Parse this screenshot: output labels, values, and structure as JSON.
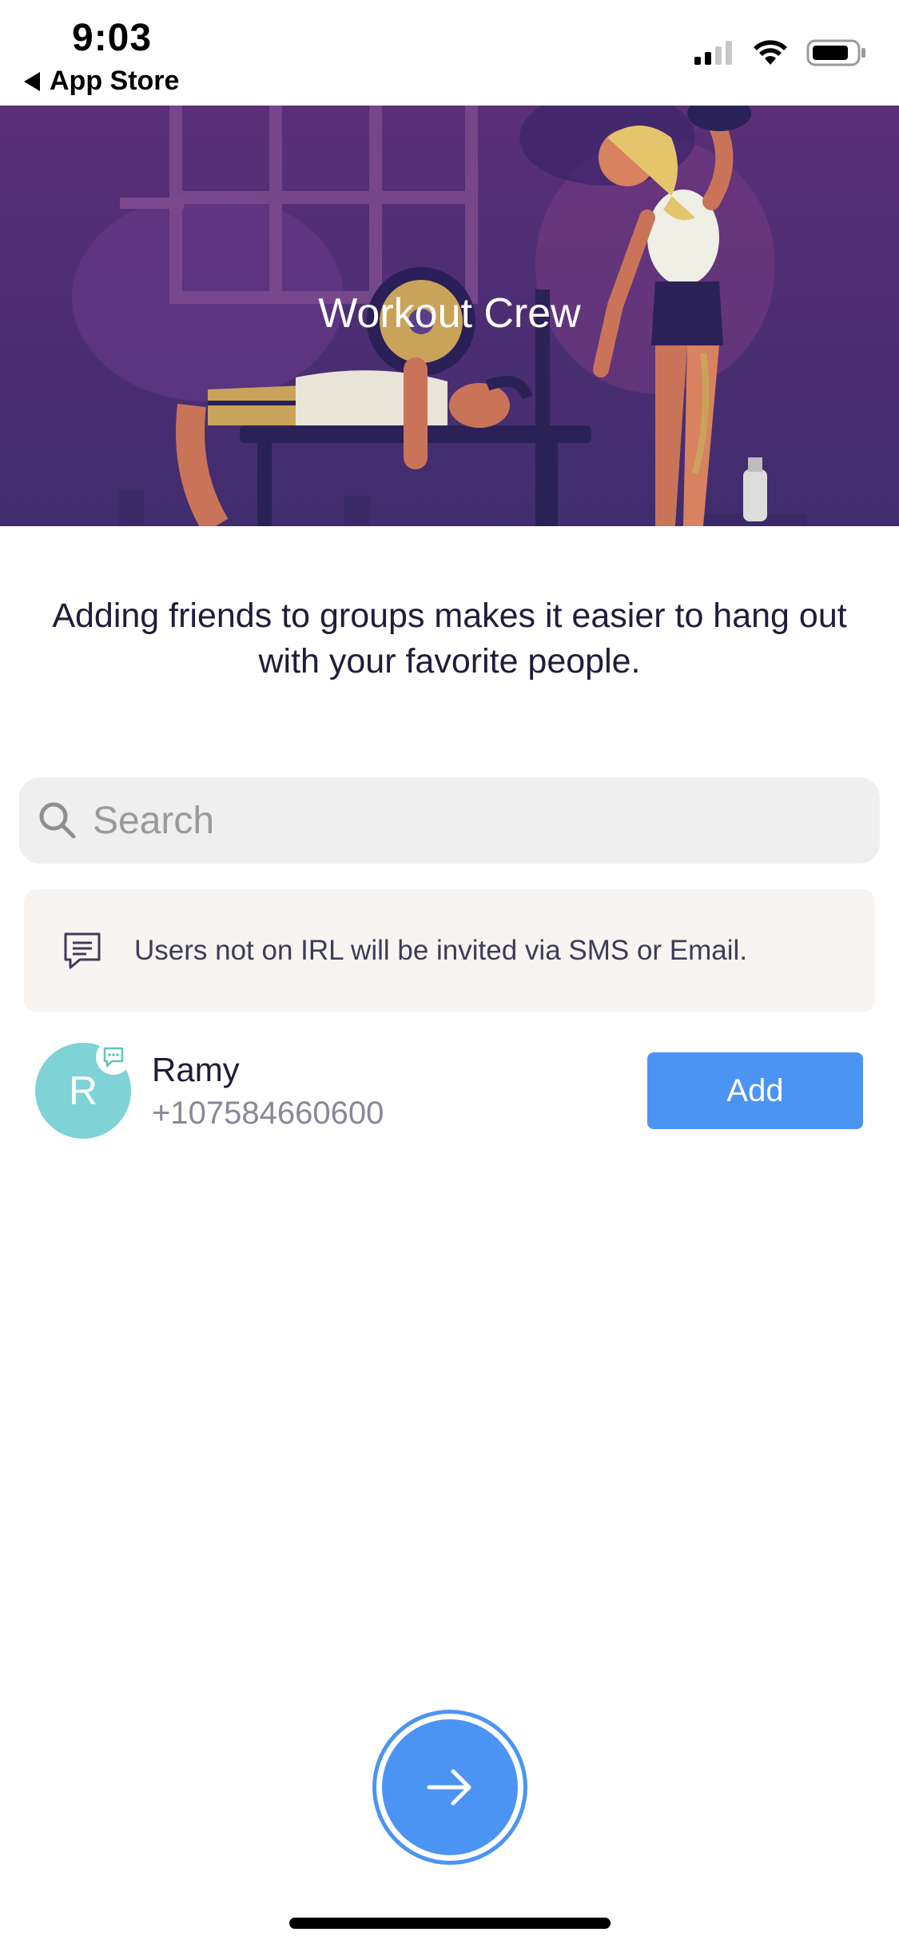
{
  "status_bar": {
    "time": "9:03",
    "back_app_label": "App Store"
  },
  "hero": {
    "title": "Workout Crew"
  },
  "intro_text": "Adding friends to groups makes it easier to hang out with your favorite people.",
  "search": {
    "placeholder": "Search",
    "value": ""
  },
  "notice": {
    "icon": "message-icon",
    "text": "Users not on IRL will be invited via SMS or Email."
  },
  "contacts": [
    {
      "initial": "R",
      "name": "Ramy",
      "phone": "+107584660600",
      "action_label": "Add",
      "avatar_color": "#7fd2d6"
    }
  ],
  "colors": {
    "accent": "#4c94f4",
    "hero_background": "#4c2f77",
    "text_primary": "#1f1d3a"
  },
  "next_button": {
    "icon": "arrow-right-icon"
  }
}
